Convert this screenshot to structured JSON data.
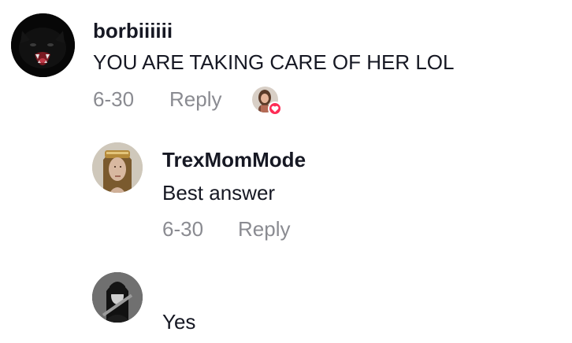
{
  "comments": [
    {
      "username": "borbiiiiii",
      "text": "YOU ARE TAKING CARE OF HER LOL",
      "date": "6-30",
      "reply_label": "Reply",
      "avatar_icon": "black-cat-avatar",
      "liked_by_creator": true
    }
  ],
  "replies": [
    {
      "username": "TrexMomMode",
      "text": "Best answer",
      "date": "6-30",
      "reply_label": "Reply",
      "avatar_icon": "woman-headdress-avatar"
    },
    {
      "username": "",
      "text": "Yes",
      "avatar_icon": "dark-warrior-avatar"
    }
  ],
  "colors": {
    "text_primary": "#161823",
    "text_secondary": "#8a8b91",
    "like_badge": "#fe2c55"
  }
}
